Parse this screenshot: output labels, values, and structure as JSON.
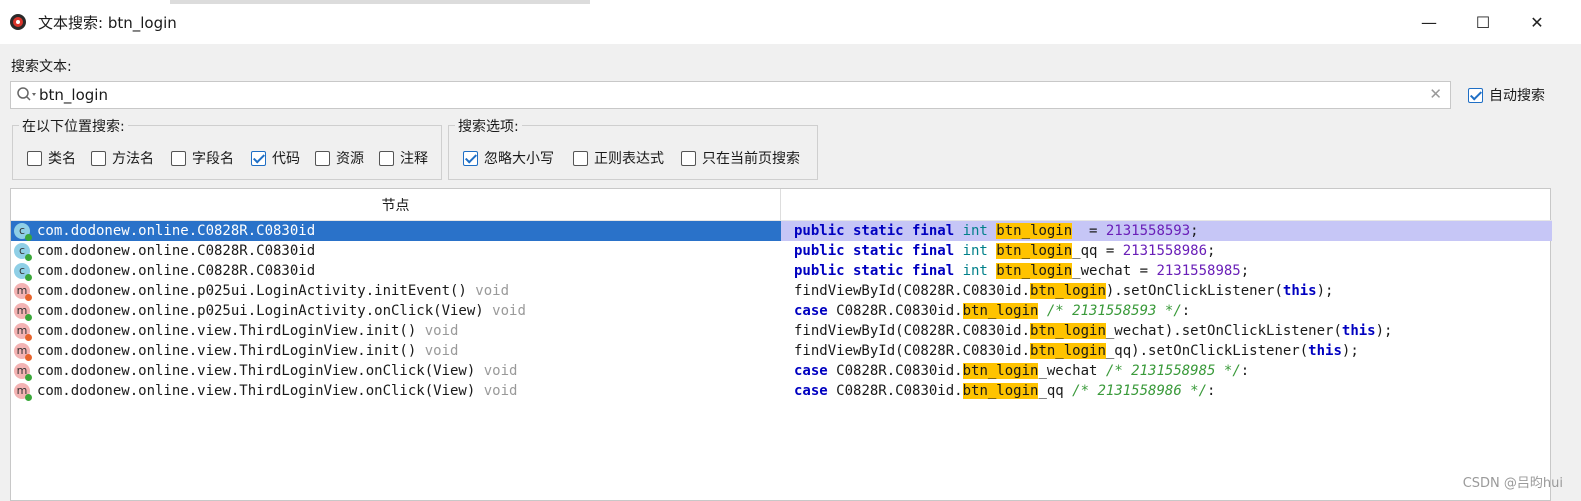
{
  "window": {
    "title": "文本搜索: btn_login",
    "minimize": "—",
    "maximize": "☐",
    "close": "✕"
  },
  "search": {
    "label": "搜索文本:",
    "value": "btn_login",
    "auto_label": "自动搜索",
    "auto_checked": true
  },
  "location_group": {
    "legend": "在以下位置搜索:",
    "options": [
      {
        "label": "类名",
        "checked": false
      },
      {
        "label": "方法名",
        "checked": false
      },
      {
        "label": "字段名",
        "checked": false
      },
      {
        "label": "代码",
        "checked": true
      },
      {
        "label": "资源",
        "checked": false
      },
      {
        "label": "注释",
        "checked": false
      }
    ]
  },
  "options_group": {
    "legend": "搜索选项:",
    "options": [
      {
        "label": "忽略大小写",
        "checked": true
      },
      {
        "label": "正则表达式",
        "checked": false
      },
      {
        "label": "只在当前页搜索",
        "checked": false
      }
    ]
  },
  "table": {
    "header": "节点",
    "rows": [
      {
        "icon": "C",
        "dot": "green",
        "node": "com.dodonew.online.C0828R.C0830id",
        "ret": "",
        "code": [
          [
            "kw",
            "public static final "
          ],
          [
            "ty",
            "int "
          ],
          [
            "hl",
            "btn_login"
          ],
          [
            "",
            "  = "
          ],
          [
            "num",
            "2131558593"
          ],
          [
            "",
            ";"
          ]
        ]
      },
      {
        "icon": "C",
        "dot": "green",
        "node": "com.dodonew.online.C0828R.C0830id",
        "ret": "",
        "code": [
          [
            "kw",
            "public static final "
          ],
          [
            "ty",
            "int "
          ],
          [
            "hl",
            "btn_login"
          ],
          [
            "",
            "_qq = "
          ],
          [
            "num",
            "2131558986"
          ],
          [
            "",
            ";"
          ]
        ]
      },
      {
        "icon": "C",
        "dot": "green",
        "node": "com.dodonew.online.C0828R.C0830id",
        "ret": "",
        "code": [
          [
            "kw",
            "public static final "
          ],
          [
            "ty",
            "int "
          ],
          [
            "hl",
            "btn_login"
          ],
          [
            "",
            "_wechat = "
          ],
          [
            "num",
            "2131558985"
          ],
          [
            "",
            ";"
          ]
        ]
      },
      {
        "icon": "m",
        "dot": "orange",
        "node": "com.dodonew.online.p025ui.LoginActivity.initEvent()",
        "ret": "void",
        "code": [
          [
            "",
            "findViewById(C0828R.C0830id."
          ],
          [
            "hl",
            "btn_login"
          ],
          [
            "",
            ").setOnClickListener("
          ],
          [
            "kw",
            "this"
          ],
          [
            "",
            ");"
          ]
        ]
      },
      {
        "icon": "m",
        "dot": "green",
        "node": "com.dodonew.online.p025ui.LoginActivity.onClick(View)",
        "ret": "void",
        "code": [
          [
            "kw",
            "case "
          ],
          [
            "",
            "C0828R.C0830id."
          ],
          [
            "hl",
            "btn_login"
          ],
          [
            "cm",
            " /* 2131558593 */"
          ],
          [
            "",
            ":"
          ]
        ]
      },
      {
        "icon": "m",
        "dot": "orange",
        "node": "com.dodonew.online.view.ThirdLoginView.init()",
        "ret": "void",
        "code": [
          [
            "",
            "findViewById(C0828R.C0830id."
          ],
          [
            "hl",
            "btn_login"
          ],
          [
            "",
            "_wechat).setOnClickListener("
          ],
          [
            "kw",
            "this"
          ],
          [
            "",
            ");"
          ]
        ]
      },
      {
        "icon": "m",
        "dot": "orange",
        "node": "com.dodonew.online.view.ThirdLoginView.init()",
        "ret": "void",
        "code": [
          [
            "",
            "findViewById(C0828R.C0830id."
          ],
          [
            "hl",
            "btn_login"
          ],
          [
            "",
            "_qq).setOnClickListener("
          ],
          [
            "kw",
            "this"
          ],
          [
            "",
            ");"
          ]
        ]
      },
      {
        "icon": "m",
        "dot": "green",
        "node": "com.dodonew.online.view.ThirdLoginView.onClick(View)",
        "ret": "void",
        "code": [
          [
            "kw",
            "case "
          ],
          [
            "",
            "C0828R.C0830id."
          ],
          [
            "hl",
            "btn_login"
          ],
          [
            "",
            "_wechat"
          ],
          [
            "cm",
            " /* 2131558985 */"
          ],
          [
            "",
            ":"
          ]
        ]
      },
      {
        "icon": "m",
        "dot": "green",
        "node": "com.dodonew.online.view.ThirdLoginView.onClick(View)",
        "ret": "void",
        "code": [
          [
            "kw",
            "case "
          ],
          [
            "",
            "C0828R.C0830id."
          ],
          [
            "hl",
            "btn_login"
          ],
          [
            "",
            "_qq"
          ],
          [
            "cm",
            " /* 2131558986 */"
          ],
          [
            "",
            ":"
          ]
        ]
      }
    ],
    "selected_index": 0
  },
  "watermark": "CSDN @吕昀hui",
  "colors": {
    "selection": "#2a72c9",
    "code_selection": "#c6c6f6",
    "highlight": "#ffc300",
    "green_dot": "#3aa83a",
    "orange_dot": "#e8642c"
  }
}
